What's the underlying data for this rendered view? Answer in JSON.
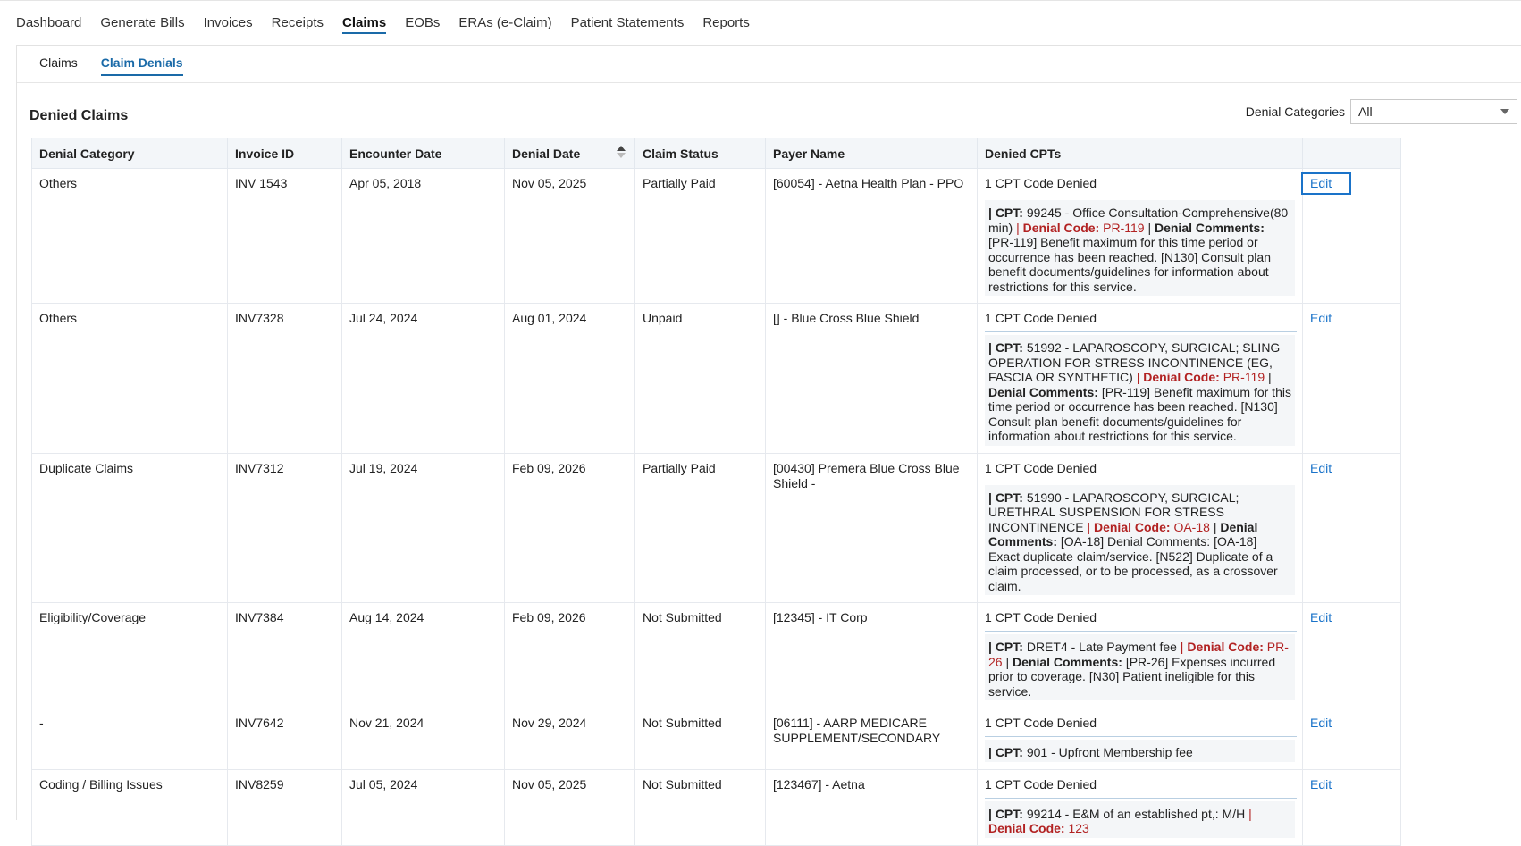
{
  "topnav": {
    "items": [
      "Dashboard",
      "Generate Bills",
      "Invoices",
      "Receipts",
      "Claims",
      "EOBs",
      "ERAs (e-Claim)",
      "Patient Statements",
      "Reports"
    ],
    "active": "Claims"
  },
  "subtabs": {
    "items": [
      "Claims",
      "Claim Denials"
    ],
    "active": "Claim Denials"
  },
  "section_title": "Denied Claims",
  "filter": {
    "label": "Denial Categories",
    "value": "All"
  },
  "table": {
    "headers": [
      "Denial Category",
      "Invoice ID",
      "Encounter Date",
      "Denial Date",
      "Claim Status",
      "Payer Name",
      "Denied CPTs",
      ""
    ],
    "edit_label": "Edit",
    "rows": [
      {
        "category": "Others",
        "invoice": "INV 1543",
        "encounter": "Apr 05, 2018",
        "denial_date": "Nov 05, 2025",
        "status": "Partially Paid",
        "payer": "[60054] - Aetna Health Plan - PPO",
        "cpt_summary": "1 CPT Code Denied",
        "cpt": {
          "code": "99245 - Office Consultation-Comprehensive(80 min)",
          "denial_code": "PR-119",
          "comments": "[PR-119] Benefit maximum for this time period or occurrence has been reached. [N130] Consult plan benefit documents/guidelines for information about restrictions for this service."
        }
      },
      {
        "category": "Others",
        "invoice": "INV7328",
        "encounter": "Jul 24, 2024",
        "denial_date": "Aug 01, 2024",
        "status": "Unpaid",
        "payer": "[] - Blue Cross Blue Shield",
        "cpt_summary": "1 CPT Code Denied",
        "cpt": {
          "code": "51992 - LAPAROSCOPY, SURGICAL; SLING OPERATION FOR STRESS INCONTINENCE (EG, FASCIA OR SYNTHETIC)",
          "denial_code": "PR-119",
          "comments": "[PR-119] Benefit maximum for this time period or occurrence has been reached. [N130] Consult plan benefit documents/guidelines for information about restrictions for this service."
        }
      },
      {
        "category": "Duplicate Claims",
        "invoice": "INV7312",
        "encounter": "Jul 19, 2024",
        "denial_date": "Feb 09, 2026",
        "status": "Partially Paid",
        "payer": "[00430] Premera Blue Cross Blue Shield -",
        "cpt_summary": "1 CPT Code Denied",
        "cpt": {
          "code": "51990 - LAPAROSCOPY, SURGICAL; URETHRAL SUSPENSION FOR STRESS INCONTINENCE",
          "denial_code": "OA-18",
          "comments": "[OA-18] Denial Comments: [OA-18] Exact duplicate claim/service. [N522] Duplicate of a claim processed, or to be processed, as a crossover claim."
        }
      },
      {
        "category": "Eligibility/Coverage",
        "invoice": "INV7384",
        "encounter": "Aug 14, 2024",
        "denial_date": "Feb 09, 2026",
        "status": "Not Submitted",
        "payer": "[12345] - IT Corp",
        "cpt_summary": "1 CPT Code Denied",
        "cpt": {
          "code": "DRET4 - Late Payment fee",
          "denial_code": "PR-26",
          "comments": "[PR-26] Expenses incurred prior to coverage. [N30] Patient ineligible for this service."
        }
      },
      {
        "category": "-",
        "invoice": "INV7642",
        "encounter": "Nov 21, 2024",
        "denial_date": "Nov 29, 2024",
        "status": "Not Submitted",
        "payer": "[06111] - AARP MEDICARE SUPPLEMENT/SECONDARY",
        "cpt_summary": "1 CPT Code Denied",
        "cpt": {
          "code": "901 - Upfront Membership fee",
          "denial_code": "",
          "comments": ""
        }
      },
      {
        "category": "Coding / Billing Issues",
        "invoice": "INV8259",
        "encounter": "Jul 05, 2024",
        "denial_date": "Nov 05, 2025",
        "status": "Not Submitted",
        "payer": "[123467] - Aetna",
        "cpt_summary": "1 CPT Code Denied",
        "cpt": {
          "code": "99214 - E&M of an established pt,: M/H",
          "denial_code": "123",
          "comments": ""
        }
      }
    ]
  },
  "labels": {
    "cpt": "CPT:",
    "denial_code": "Denial Code:",
    "denial_comments": "Denial Comments:"
  }
}
